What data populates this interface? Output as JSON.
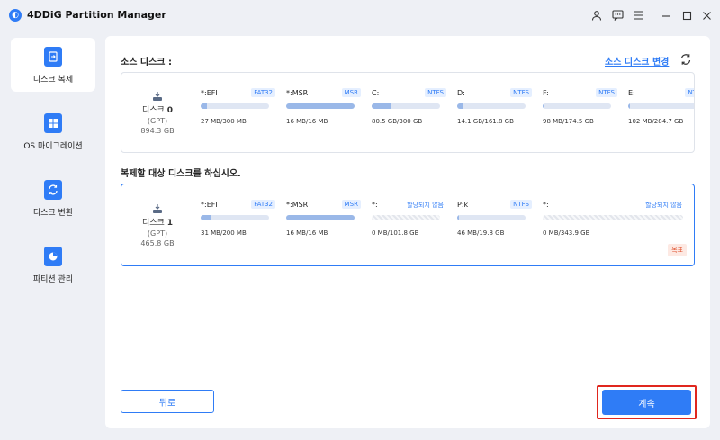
{
  "window": {
    "title": "4DDiG Partition Manager"
  },
  "sidebar": {
    "items": [
      {
        "label": "디스크 복제"
      },
      {
        "label": "OS 마이그레이션"
      },
      {
        "label": "디스크 변환"
      },
      {
        "label": "파티션 관리"
      }
    ]
  },
  "source": {
    "title": "소스 디스크 :",
    "change_label": "소스 디스크 변경",
    "disk": {
      "name_prefix": "디스크",
      "number": "0",
      "type": "(GPT)",
      "size": "894.3 GB"
    },
    "partitions": [
      {
        "name": "*:EFI",
        "fs": "FAT32",
        "usage": "27 MB/300 MB",
        "used_fraction": 0.09
      },
      {
        "name": "*:MSR",
        "fs": "MSR",
        "usage": "16 MB/16 MB",
        "used_fraction": 1.0
      },
      {
        "name": "C:",
        "fs": "NTFS",
        "usage": "80.5 GB/300 GB",
        "used_fraction": 0.27
      },
      {
        "name": "D:",
        "fs": "NTFS",
        "usage": "14.1 GB/161.8 GB",
        "used_fraction": 0.09
      },
      {
        "name": "F:",
        "fs": "NTFS",
        "usage": "98 MB/174.5 GB",
        "used_fraction": 0.02
      },
      {
        "name": "E:",
        "fs": "NTF",
        "usage": "102 MB/284.7 GB",
        "used_fraction": 0.02
      }
    ]
  },
  "target": {
    "title": "복제할 대상 디스크를 하십시오.",
    "disk": {
      "name_prefix": "디스크",
      "number": "1",
      "type": "(GPT)",
      "size": "465.8 GB"
    },
    "partitions": [
      {
        "name": "*:EFI",
        "fs": "FAT32",
        "usage": "31 MB/200 MB",
        "used_fraction": 0.15
      },
      {
        "name": "*:MSR",
        "fs": "MSR",
        "usage": "16 MB/16 MB",
        "used_fraction": 1.0
      },
      {
        "name": "*:",
        "fs": "할당되지 않음",
        "usage": "0 MB/101.8 GB",
        "used_fraction": 0,
        "unallocated": true
      },
      {
        "name": "P:k",
        "fs": "NTFS",
        "usage": "46 MB/19.8 GB",
        "used_fraction": 0.02
      },
      {
        "name": "*:",
        "fs": "할당되지 않음",
        "usage": "0 MB/343.9 GB",
        "used_fraction": 0,
        "unallocated": true,
        "wide": true
      }
    ],
    "badge": "목표"
  },
  "buttons": {
    "back": "뒤로",
    "next": "계속"
  },
  "colors": {
    "accent": "#2f7cf6",
    "highlight": "#e0271e"
  }
}
